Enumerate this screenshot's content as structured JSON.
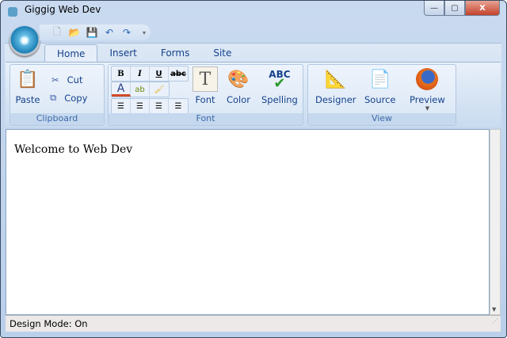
{
  "window": {
    "title": "Giggig Web Dev",
    "minimize": "—",
    "maximize": "▢",
    "close": "X"
  },
  "qat": {
    "items": [
      "new",
      "open",
      "save",
      "undo",
      "redo",
      "customize"
    ]
  },
  "tabs": [
    "Home",
    "Insert",
    "Forms",
    "Site"
  ],
  "groups": {
    "clipboard": {
      "label": "Clipboard",
      "paste": "Paste",
      "cut": "Cut",
      "copy": "Copy"
    },
    "font": {
      "label": "Font",
      "bold": "B",
      "italic": "I",
      "underline": "U",
      "strike": "abc",
      "font": "Font",
      "color": "Color",
      "spelling": "Spelling",
      "spelling_icon": "ABC"
    },
    "view": {
      "label": "View",
      "designer": "Designer",
      "source": "Source",
      "preview": "Preview"
    }
  },
  "content": {
    "text": "Welcome to Web Dev"
  },
  "status": {
    "text": "Design Mode: On"
  }
}
